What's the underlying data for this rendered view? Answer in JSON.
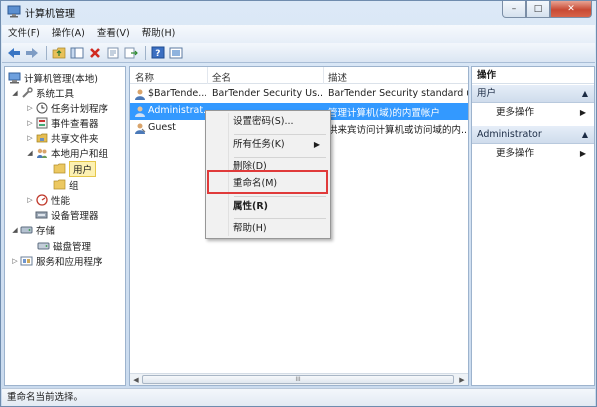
{
  "window": {
    "title": "计算机管理",
    "controls": {
      "minimize": "–",
      "maximize": "□",
      "close": "✕"
    }
  },
  "menubar": {
    "items": [
      "文件(F)",
      "操作(A)",
      "查看(V)",
      "帮助(H)"
    ]
  },
  "toolbar": {
    "icons": [
      "back-arrow-icon",
      "forward-arrow-icon",
      "up-folder-icon",
      "show-hide-tree-icon",
      "delete-icon",
      "properties-icon",
      "export-icon",
      "help-icon",
      "console-icon"
    ]
  },
  "tree": {
    "root": "计算机管理(本地)",
    "system_tools": "系统工具",
    "task_scheduler": "任务计划程序",
    "event_viewer": "事件查看器",
    "shared_folders": "共享文件夹",
    "local_users_groups": "本地用户和组",
    "users": "用户",
    "groups": "组",
    "performance": "性能",
    "device_manager": "设备管理器",
    "storage": "存储",
    "disk_management": "磁盘管理",
    "services_apps": "服务和应用程序"
  },
  "list": {
    "columns": [
      "名称",
      "全名",
      "描述"
    ],
    "rows": [
      {
        "name": "$BarTende...",
        "full_name": "BarTender Security Us...",
        "description": "BarTender Security standard u..."
      },
      {
        "name": "Administrat...",
        "full_name": "",
        "description": "管理计算机(域)的内置帐户"
      },
      {
        "name": "Guest",
        "full_name": "",
        "description": "供来宾访问计算机或访问域的内..."
      }
    ],
    "scroll_grip": "III"
  },
  "context_menu": {
    "set_password": "设置密码(S)...",
    "all_tasks": "所有任务(K)",
    "delete": "删除(D)",
    "rename": "重命名(M)",
    "properties": "属性(R)",
    "help": "帮助(H)"
  },
  "actions": {
    "header": "操作",
    "section_users": "用户",
    "more_actions_1": "更多操作",
    "section_admin": "Administrator",
    "more_actions_2": "更多操作"
  },
  "statusbar": {
    "text": "重命名当前选择。"
  },
  "colors": {
    "selection": "#3399ff",
    "highlight_box": "#e03a3a",
    "tree_selected": "#fdf1b2"
  }
}
